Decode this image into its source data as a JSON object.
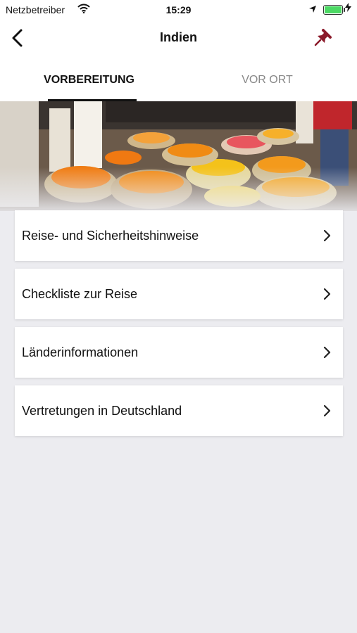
{
  "status_bar": {
    "carrier": "Netzbetreiber",
    "time": "15:29",
    "wifi_icon": "wifi-icon",
    "location_icon": "location-arrow-icon",
    "battery_icon": "battery-icon",
    "charging_icon": "charging-bolt-icon",
    "battery_color": "#4cd964"
  },
  "nav": {
    "title": "Indien",
    "back_icon": "chevron-left-icon",
    "pin_icon": "pushpin-icon",
    "pin_color": "#8b1a2b"
  },
  "tabs": [
    {
      "label": "VORBEREITUNG",
      "active": true
    },
    {
      "label": "VOR ORT",
      "active": false
    }
  ],
  "hero": {
    "image": "flower-market-photo"
  },
  "menu": {
    "items": [
      {
        "label": "Reise- und Sicherheitshinweise"
      },
      {
        "label": "Checkliste zur Reise"
      },
      {
        "label": "Länderinformationen"
      },
      {
        "label": "Vertretungen in Deutschland"
      }
    ],
    "chevron_icon": "chevron-right-icon"
  }
}
